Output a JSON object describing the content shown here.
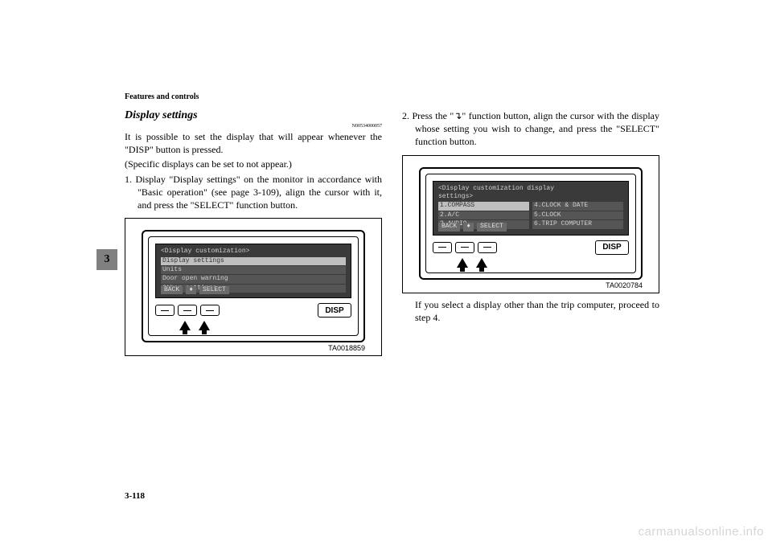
{
  "header": "Features and controls",
  "sideTab": "3",
  "pageNum": "3-118",
  "watermark": "carmanualsonline.info",
  "left": {
    "heading": "Display settings",
    "refcode": "N00534000057",
    "para1": "It is possible to set the display that will appear whenever the \"DISP\" button is pressed.",
    "para2": "(Specific displays can be set to not appear.)",
    "step1": "1. Display \"Display settings\" on the monitor in accordance with \"Basic operation\" (see page 3-109), align the cursor with it, and press the \"SELECT\" function button.",
    "fig": {
      "title": "<Display customization>",
      "row1": "Display settings",
      "row2": "Units",
      "row3": "Door open warning",
      "row4": "Other settings",
      "footerBack": "BACK",
      "footerSelect": "SELECT",
      "disp": "DISP",
      "id": "TA0018859"
    }
  },
  "right": {
    "step2a": "2. Press the \"",
    "step2b": "\" function button, align the cursor with the display whose setting you wish to change, and press the \"SELECT\" function button.",
    "fig": {
      "title1": "<Display customization display",
      "title2": " settings>",
      "l1": "1.COMPASS",
      "l2": "2.A/C",
      "l3": "3.AUDIO",
      "r1": "4.CLOCK & DATE",
      "r2": "5.CLOCK",
      "r3": "6.TRIP COMPUTER",
      "footerBack": "BACK",
      "footerSelect": "SELECT",
      "disp": "DISP",
      "id": "TA0020784"
    },
    "after": "If you select a display other than the trip computer, proceed to step 4."
  }
}
